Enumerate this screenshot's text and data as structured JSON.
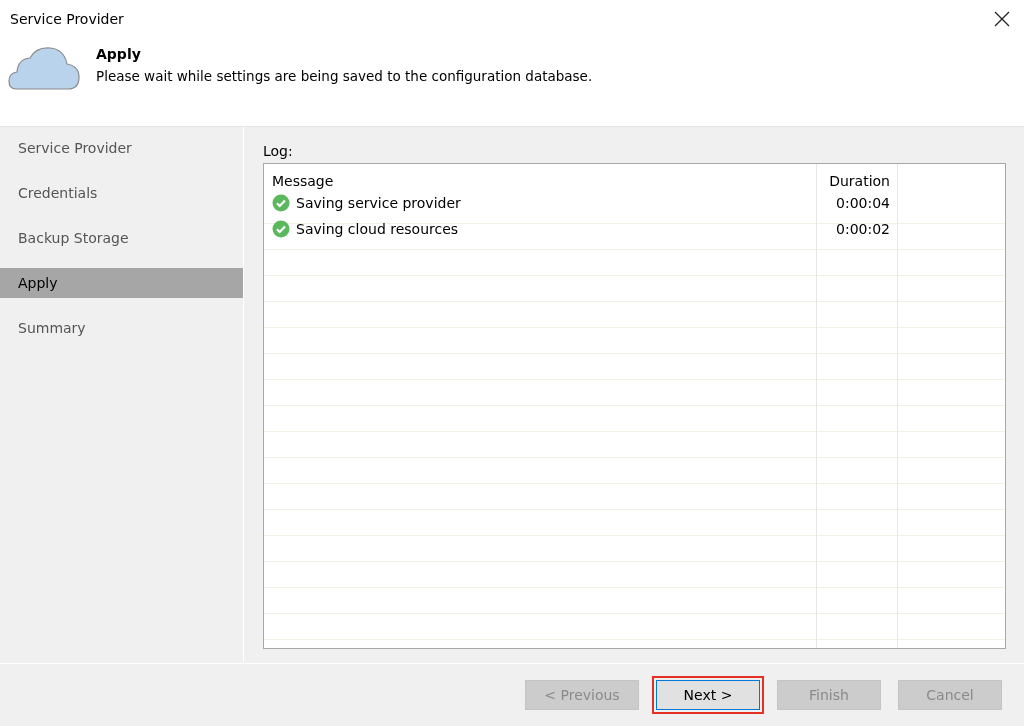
{
  "window": {
    "title": "Service Provider"
  },
  "header": {
    "title": "Apply",
    "description": "Please wait while settings are being saved to the configuration database."
  },
  "sidebar": {
    "items": [
      {
        "label": "Service Provider",
        "selected": false
      },
      {
        "label": "Credentials",
        "selected": false
      },
      {
        "label": "Backup Storage",
        "selected": false
      },
      {
        "label": "Apply",
        "selected": true
      },
      {
        "label": "Summary",
        "selected": false
      }
    ]
  },
  "log": {
    "label": "Log:",
    "columns": [
      "Message",
      "Duration"
    ],
    "rows": [
      {
        "kind": "success",
        "message": "Saving service provider",
        "duration": "0:00:04"
      },
      {
        "kind": "success",
        "message": "Saving cloud resources",
        "duration": "0:00:02"
      }
    ]
  },
  "buttons": [
    {
      "label": "< Previous",
      "disabled": true,
      "highlighted": false
    },
    {
      "label": "Next >",
      "disabled": false,
      "highlighted": true
    },
    {
      "label": "Finish",
      "disabled": true,
      "highlighted": false
    },
    {
      "label": "Cancel",
      "disabled": true,
      "highlighted": false
    }
  ]
}
